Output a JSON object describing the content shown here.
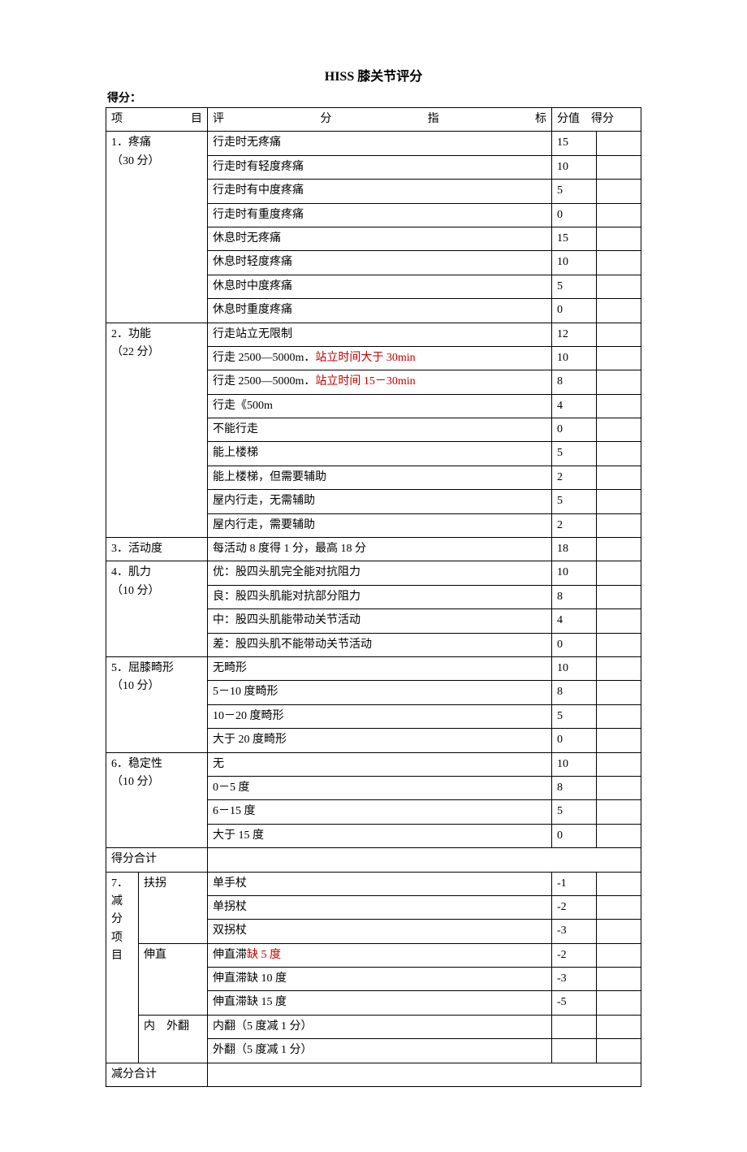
{
  "title": "HISS 膝关节评分",
  "score_label": "得分：",
  "headers": {
    "item": "项　　目",
    "criteria": "评　分　指　标",
    "value": "分值",
    "score": "得分"
  },
  "sections": [
    {
      "category": [
        "1．疼痛",
        "（30 分）"
      ],
      "rows": [
        {
          "text": "行走时无疼痛",
          "value": "15"
        },
        {
          "text": "行走时有轻度疼痛",
          "value": "10"
        },
        {
          "text": "行走时有中度疼痛",
          "value": "5"
        },
        {
          "text": "行走时有重度疼痛",
          "value": "0"
        },
        {
          "text": "休息时无疼痛",
          "value": "15"
        },
        {
          "text": "休息时轻度疼痛",
          "value": "10"
        },
        {
          "text": "休息时中度疼痛",
          "value": "5"
        },
        {
          "text": "休息时重度疼痛",
          "value": "0"
        }
      ]
    },
    {
      "category": [
        "2．功能",
        "（22 分）"
      ],
      "rows": [
        {
          "text": "行走站立无限制",
          "value": "12"
        },
        {
          "text_pre": "行走 2500—5000m．",
          "text_red": "站立时间大于 30min",
          "value": "10"
        },
        {
          "text_pre": "行走 2500—5000m．",
          "text_red": "站立时间 15－30min",
          "value": "8"
        },
        {
          "text": "行走《500m",
          "value": "4"
        },
        {
          "text": "不能行走",
          "value": "0"
        },
        {
          "text": "能上楼梯",
          "value": "5"
        },
        {
          "text": "能上楼梯，但需要辅助",
          "value": "2"
        },
        {
          "text": "屋内行走，无需辅助",
          "value": "5"
        },
        {
          "text": "屋内行走，需要辅助",
          "value": "2"
        }
      ]
    },
    {
      "category": [
        "3．活动度"
      ],
      "rows": [
        {
          "text": "每活动 8 度得 1 分，最高 18 分",
          "value": "18"
        }
      ]
    },
    {
      "category": [
        "4．肌力",
        "（10 分）"
      ],
      "rows": [
        {
          "text": "优：股四头肌完全能对抗阻力",
          "value": "10"
        },
        {
          "text": "良：股四头肌能对抗部分阻力",
          "value": "8"
        },
        {
          "text": "中：股四头肌能带动关节活动",
          "value": "4"
        },
        {
          "text": "差：股四头肌不能带动关节活动",
          "value": "0"
        }
      ]
    },
    {
      "category": [
        "5．屈膝畸形",
        "（10 分）"
      ],
      "rows": [
        {
          "text": "无畸形",
          "value": "10"
        },
        {
          "text": "5－10 度畸形",
          "value": "8"
        },
        {
          "text": "10－20 度畸形",
          "value": "5"
        },
        {
          "text": "大于 20 度畸形",
          "value": "0"
        }
      ]
    },
    {
      "category": [
        "6．稳定性",
        "（10 分）"
      ],
      "rows": [
        {
          "text": "无",
          "value": "10"
        },
        {
          "text": "0－5 度",
          "value": "8"
        },
        {
          "text": "6－15 度",
          "value": "5"
        },
        {
          "text": "大于 15 度",
          "value": "0"
        }
      ]
    }
  ],
  "subtotal_score": "得分合计",
  "deduction_header": [
    "7．",
    "减",
    "分",
    "项",
    "目"
  ],
  "deduction_groups": [
    {
      "sub": "扶拐",
      "rows": [
        {
          "text": "单手杖",
          "value": "-1"
        },
        {
          "text": "单拐杖",
          "value": "-2"
        },
        {
          "text": "双拐杖",
          "value": "-3"
        }
      ]
    },
    {
      "sub": "伸直",
      "rows": [
        {
          "text_pre": "伸直滞",
          "text_red": "缺 5 度",
          "value": "-2"
        },
        {
          "text": "伸直滞缺 10 度",
          "value": "-3"
        },
        {
          "text": "伸直滞缺 15 度",
          "value": "-5"
        }
      ]
    },
    {
      "sub": "内　外翻",
      "rows": [
        {
          "text": "内翻（5 度减 1 分）",
          "value": ""
        },
        {
          "text": "外翻（5 度减 1 分）",
          "value": ""
        }
      ]
    }
  ],
  "subtotal_deduction": "减分合计"
}
